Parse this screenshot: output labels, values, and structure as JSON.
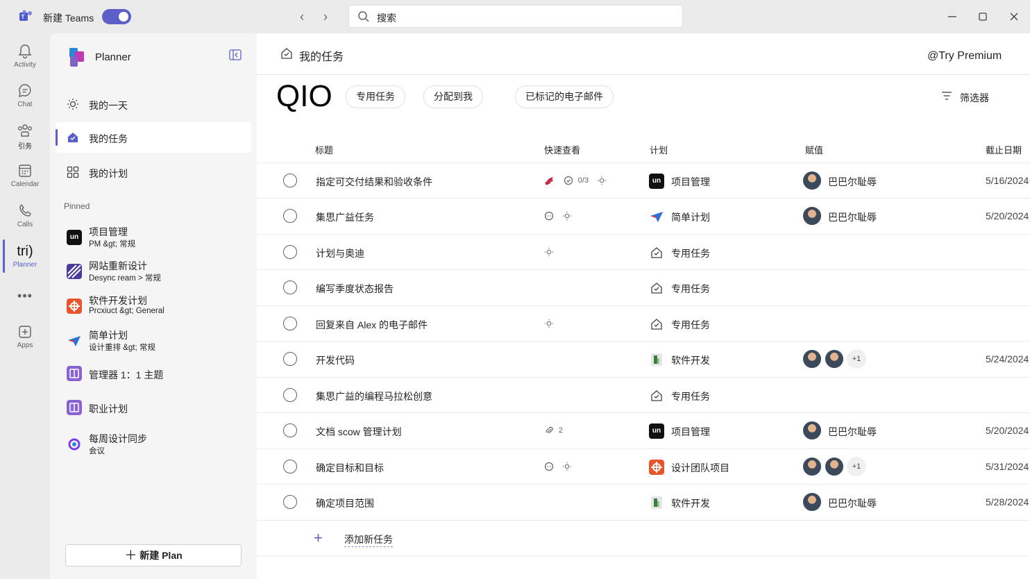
{
  "titlebar": {
    "app_name": "新建 Teams",
    "search_placeholder": "搜索"
  },
  "rail": {
    "items": [
      {
        "label": "Activity",
        "icon": "bell-icon"
      },
      {
        "label": "Chat",
        "icon": "chat-icon"
      },
      {
        "label": "引务",
        "icon": "teams-icon"
      },
      {
        "label": "Calendar",
        "icon": "calendar-icon"
      },
      {
        "label": "Calls",
        "icon": "phone-icon"
      },
      {
        "label": "Planner",
        "icon_text": "tri)"
      },
      {
        "label": "Apps",
        "icon": "plus-box-icon"
      }
    ]
  },
  "sidebar": {
    "title": "Planner",
    "nav": [
      {
        "label": "我的一天",
        "icon": "sun-icon"
      },
      {
        "label": "我的任务",
        "icon": "home-check-icon"
      },
      {
        "label": "我的计划",
        "icon": "grid-icon"
      }
    ],
    "pinned_label": "Pinned",
    "pinned": [
      {
        "title": "项目管理",
        "sub": "PM &gt; 常规",
        "color": "#111111"
      },
      {
        "title": "网站重新设计",
        "sub": "Desync ream  >  常规",
        "color": "#4b3b9a"
      },
      {
        "title": "软件开发计划",
        "sub": "Prcxiuct &gt; General",
        "color": "#e8542b"
      },
      {
        "title": "简单计划",
        "sub": "设计重排 &gt; 常规",
        "color": "#ffffff"
      },
      {
        "title": "管理器 1：1 主题",
        "sub": "",
        "color": "#8a63d2"
      },
      {
        "title": "职业计划",
        "sub": "",
        "color": "#8a63d2"
      },
      {
        "title": "每周设计同步",
        "sub": "会议",
        "color": "#ffffff"
      }
    ],
    "new_plan": "新建  Plan"
  },
  "main": {
    "header_title": "我的任务",
    "premium": "@Try Premium",
    "big_text": "QIO",
    "pills": [
      "专用任务",
      "分配到我",
      "已标记的电子邮件"
    ],
    "filter": "筛选器",
    "columns": {
      "title": "标题",
      "quick": "快速查看",
      "plan": "计划",
      "assign": "赋值",
      "due": "截止日期"
    },
    "tasks": [
      {
        "title": "指定可交付结果和验收条件",
        "quick": "0/3",
        "plan": "项目管理",
        "assignee": "巴巴尔耻辱",
        "due": "5/16/2024"
      },
      {
        "title": "集思广益任务",
        "quick": "",
        "plan": "简单计划",
        "assignee": "巴巴尔耻辱",
        "due": "5/20/2024"
      },
      {
        "title": "计划与奥迪",
        "quick": "",
        "plan": "专用任务",
        "assignee": "",
        "due": ""
      },
      {
        "title": "编写季度状态报告",
        "quick": "",
        "plan": "专用任务",
        "assignee": "",
        "due": ""
      },
      {
        "title": "回复来自 Alex 的电子邮件",
        "quick": "",
        "plan": "专用任务",
        "assignee": "",
        "due": ""
      },
      {
        "title": "开发代码",
        "quick": "",
        "plan": "软件开发",
        "assignee": "",
        "extra": "+1",
        "due": "5/24/2024"
      },
      {
        "title": "集思广益的编程马拉松创意",
        "quick": "",
        "plan": "专用任务",
        "assignee": "",
        "due": ""
      },
      {
        "title": "文档 scow 管理计划",
        "quick": "2",
        "plan": "项目管理",
        "assignee": "巴巴尔耻辱",
        "due": "5/20/2024"
      },
      {
        "title": "确定目标和目标",
        "quick": "",
        "plan": "设计团队项目",
        "assignee": "",
        "extra": "+1",
        "due": "5/31/2024"
      },
      {
        "title": "确定项目范围",
        "quick": "",
        "plan": "软件开发",
        "assignee": "巴巴尔耻辱",
        "due": "5/28/2024"
      }
    ],
    "add_task": "添加新任务"
  },
  "colors": {
    "accent": "#5b5fc7",
    "urgent": "#c4314b"
  }
}
